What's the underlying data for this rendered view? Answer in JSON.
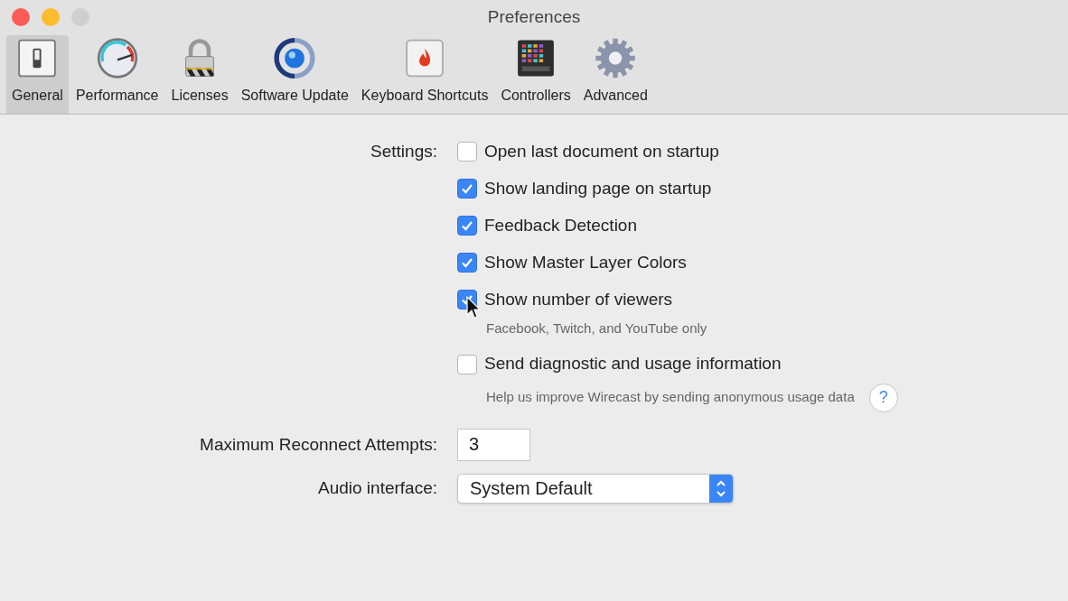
{
  "window": {
    "title": "Preferences"
  },
  "tabs": [
    {
      "label": "General",
      "kind": "switch",
      "selected": true
    },
    {
      "label": "Performance",
      "kind": "gauge",
      "selected": false
    },
    {
      "label": "Licenses",
      "kind": "lock",
      "selected": false
    },
    {
      "label": "Software Update",
      "kind": "update",
      "selected": false
    },
    {
      "label": "Keyboard Shortcuts",
      "kind": "key",
      "selected": false
    },
    {
      "label": "Controllers",
      "kind": "pad",
      "selected": false
    },
    {
      "label": "Advanced",
      "kind": "gear",
      "selected": false
    }
  ],
  "settings": {
    "label": "Settings:",
    "options": [
      {
        "label": "Open last document on startup",
        "checked": false
      },
      {
        "label": "Show landing page on startup",
        "checked": true
      },
      {
        "label": "Feedback Detection",
        "checked": true
      },
      {
        "label": "Show Master Layer Colors",
        "checked": true
      },
      {
        "label": "Show number of viewers",
        "checked": true,
        "pointer": true,
        "note": "Facebook, Twitch, and YouTube only"
      },
      {
        "label": "Send diagnostic and usage information",
        "checked": false,
        "note": "Help us improve Wirecast by sending anonymous usage data",
        "help": "?"
      }
    ]
  },
  "reconnect": {
    "label": "Maximum Reconnect Attempts:",
    "value": "3"
  },
  "audio": {
    "label": "Audio interface:",
    "value": "System Default"
  }
}
